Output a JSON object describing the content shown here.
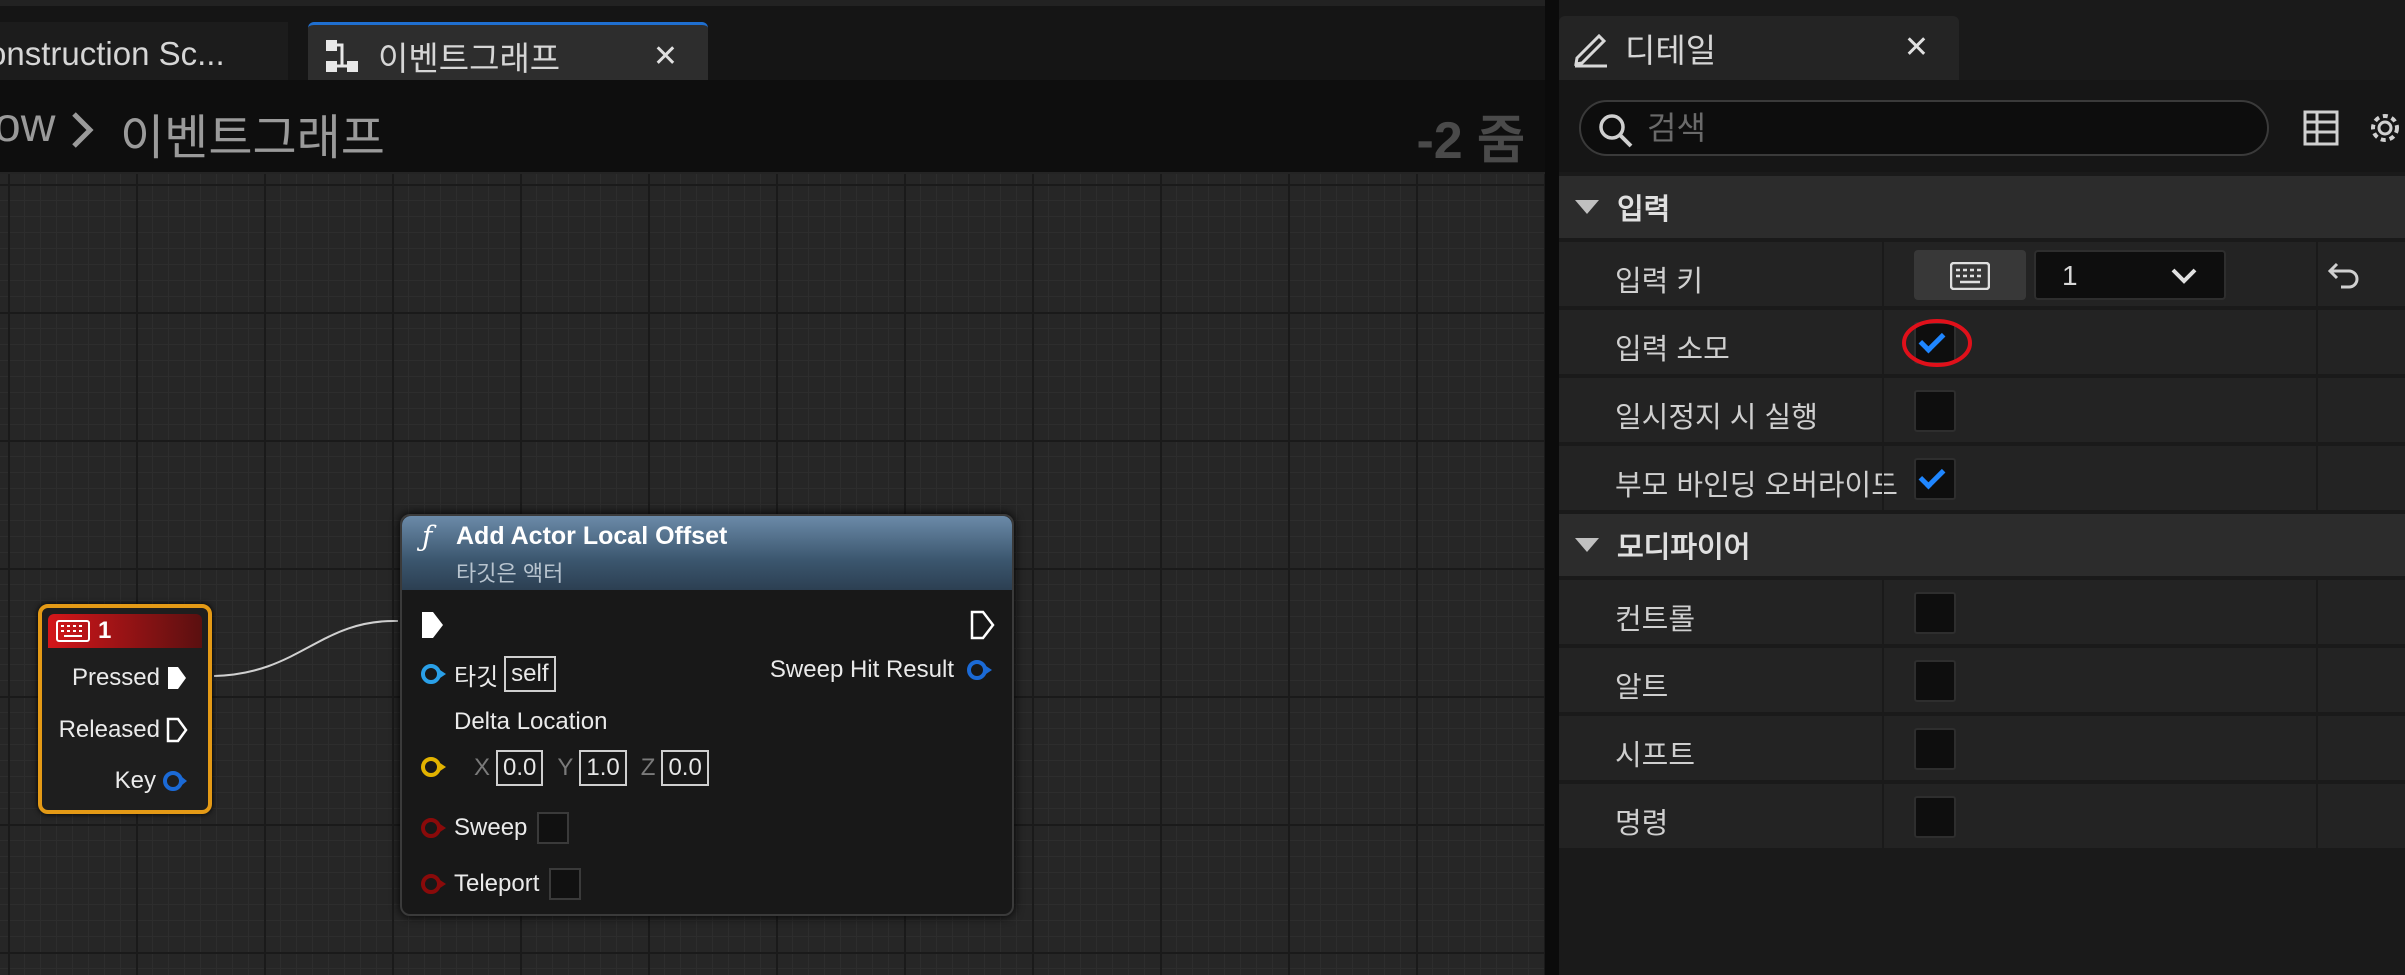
{
  "tabs": {
    "construction": "onstruction Sc...",
    "eventgraph": "이벤트그래프",
    "close_glyph": "✕"
  },
  "breadcrumb": {
    "parent": "ow",
    "separator": ">",
    "current": "이벤트그래프",
    "zoom": "-2 줌"
  },
  "event_node": {
    "title": "1",
    "pins": [
      "Pressed",
      "Released",
      "Key"
    ]
  },
  "function_node": {
    "title": "Add Actor Local Offset",
    "subtitle": "타깃은 액터",
    "target_label": "타깃",
    "target_value": "self",
    "sweep_hit_result": "Sweep Hit Result",
    "delta_location": "Delta Location",
    "x_label": "X",
    "x_value": "0.0",
    "y_label": "Y",
    "y_value": "1.0",
    "z_label": "Z",
    "z_value": "0.0",
    "sweep": "Sweep",
    "teleport": "Teleport"
  },
  "details": {
    "title": "디테일",
    "search_placeholder": "검색",
    "sections": [
      {
        "label": "입력",
        "props": [
          {
            "name": "입력 키",
            "key_value": "1"
          },
          {
            "name": "입력 소모",
            "checked": true,
            "highlighted": true
          },
          {
            "name": "일시정지 시 실행",
            "checked": false
          },
          {
            "name": "부모 바인딩 오버라이드",
            "checked": true
          }
        ]
      },
      {
        "label": "모디파이어",
        "props": [
          {
            "name": "컨트롤",
            "checked": false
          },
          {
            "name": "알트",
            "checked": false
          },
          {
            "name": "시프트",
            "checked": false
          },
          {
            "name": "명령",
            "checked": false
          }
        ]
      }
    ]
  },
  "colors": {
    "accent": "#1f6fd0",
    "check": "#1f86ff",
    "event_border": "#e49a16",
    "event_header": "#d4161a",
    "highlight": "#e0101a"
  },
  "icons": [
    "graph-icon",
    "pencil-icon",
    "search-icon",
    "table-icon",
    "gear-icon",
    "keyboard-icon",
    "chevron-down-icon",
    "reset-arrow-icon",
    "function-icon",
    "exec-pin-icon"
  ]
}
